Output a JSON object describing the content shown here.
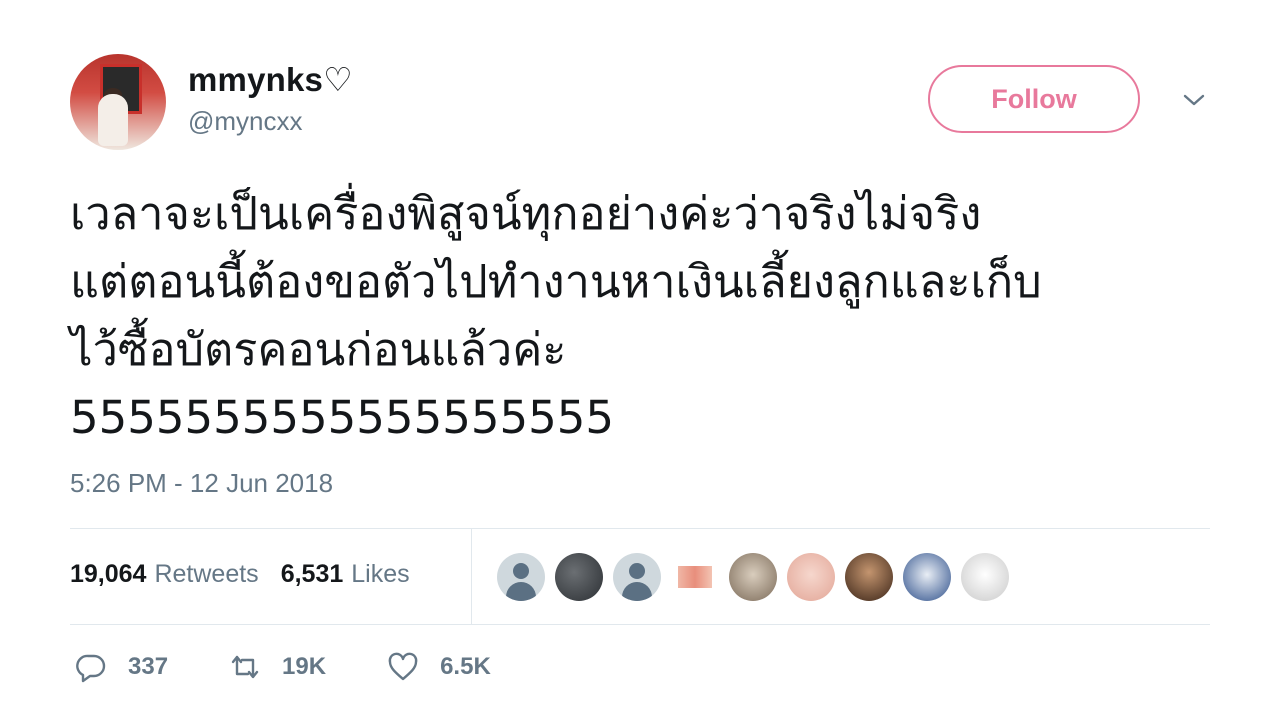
{
  "user": {
    "display_name": "mmynks",
    "heart": "♡",
    "handle": "@myncxx"
  },
  "follow_label": "Follow",
  "tweet": {
    "lines": [
      "เวลาจะเป็นเครื่องพิสูจน์ทุกอย่างค่ะว่าจริงไม่จริง",
      "แต่ตอนนี้ต้องขอตัวไปทำงานหาเงินเลี้ยงลูกและเก็บ",
      "ไว้ซื้อบัตรคอนก่อนแล้วค่ะ",
      "5555555555555555555"
    ],
    "timestamp": "5:26 PM - 12 Jun 2018"
  },
  "stats": {
    "retweets_count": "19,064",
    "retweets_label": "Retweets",
    "likes_count": "6,531",
    "likes_label": "Likes"
  },
  "actions": {
    "replies": "337",
    "retweets": "19K",
    "likes": "6.5K"
  },
  "icons": [
    "chevron-down-icon",
    "reply-icon",
    "retweet-icon",
    "heart-icon"
  ],
  "colors": {
    "accent": "#e8799c",
    "secondary_text": "#657786",
    "divider": "#e1e8ed"
  }
}
